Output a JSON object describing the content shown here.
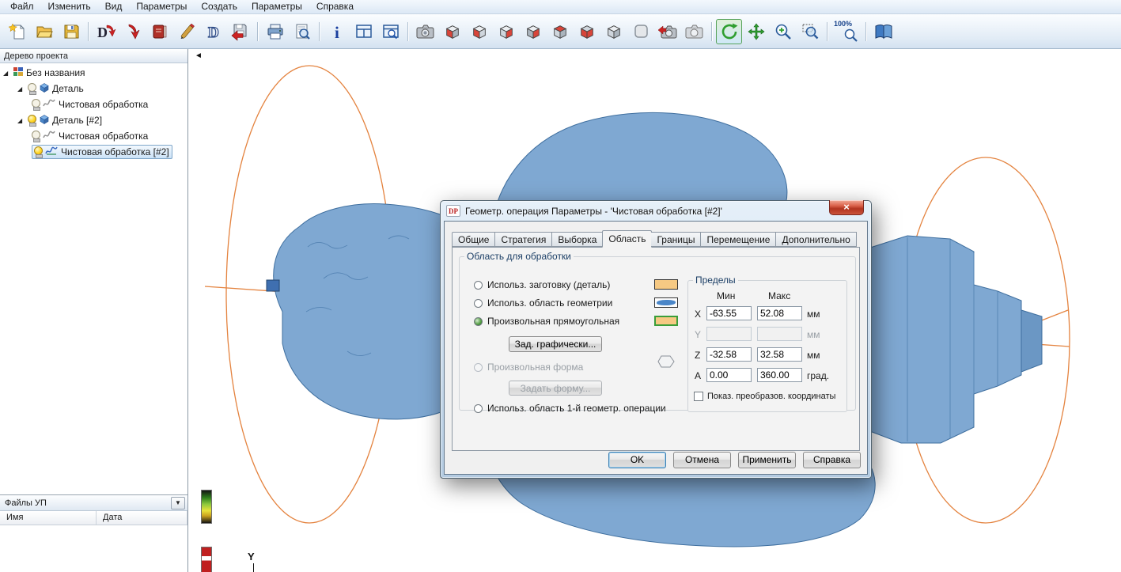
{
  "menu": {
    "items": [
      "Файл",
      "Изменить",
      "Вид",
      "Параметры",
      "Создать",
      "Параметры",
      "Справка"
    ]
  },
  "toolbar": {
    "zoom_label": "100%",
    "active_tool": "rotate",
    "icons": [
      "new-project",
      "open",
      "save",
      "import-drawing",
      "import-file",
      "library",
      "calculate",
      "drawing",
      "export-toolpath",
      "print",
      "print-preview",
      "info",
      "split-window",
      "view-window",
      "snapshot",
      "view-left",
      "view-front",
      "view-right",
      "view-back",
      "view-top",
      "view-bottom",
      "view-iso",
      "view-perspective",
      "restore-view",
      "saved-view",
      "rotate",
      "pan",
      "zoom-in",
      "zoom-window",
      "zoom-100",
      "help"
    ]
  },
  "project_tree": {
    "title": "Дерево проекта",
    "items": [
      {
        "label": "Без названия",
        "level": 0
      },
      {
        "label": "Деталь",
        "level": 1,
        "bulb": "off"
      },
      {
        "label": "Чистовая обработка",
        "level": 2,
        "bulb": "off"
      },
      {
        "label": "Деталь [#2]",
        "level": 1,
        "bulb": "on"
      },
      {
        "label": "Чистовая обработка",
        "level": 2,
        "bulb": "off"
      },
      {
        "label": "Чистовая обработка [#2]",
        "level": 2,
        "bulb": "on",
        "selected": true
      }
    ]
  },
  "files_panel": {
    "title": "Файлы УП",
    "columns": [
      "Имя",
      "Дата"
    ]
  },
  "viewport": {
    "axis_label": "Y"
  },
  "dialog": {
    "logo_text": "DP",
    "title": "Геометр. операция Параметры - 'Чистовая обработка [#2]'",
    "tabs": [
      "Общие",
      "Стратегия",
      "Выборка",
      "Область",
      "Границы",
      "Перемещение",
      "Дополнительно"
    ],
    "active_tab": "Область",
    "area_group": {
      "title": "Область для обработки",
      "options": [
        {
          "label": "Использ. заготовку (деталь)",
          "state": "unchecked"
        },
        {
          "label": "Использ. область геометрии",
          "state": "unchecked"
        },
        {
          "label": "Произвольная прямоугольная",
          "state": "checked"
        },
        {
          "label": "Произвольная форма",
          "state": "disabled"
        },
        {
          "label": "Использ. область 1-й геометр. операции",
          "state": "unchecked"
        }
      ],
      "define_graphically_button": "Зад. графически...",
      "define_shape_button": "Задать форму..."
    },
    "limits_group": {
      "title": "Пределы",
      "min_header": "Мин",
      "max_header": "Макс",
      "rows": [
        {
          "axis": "X",
          "min": "-63.55",
          "max": "52.08",
          "unit": "мм",
          "enabled": true
        },
        {
          "axis": "Y",
          "min": "",
          "max": "",
          "unit": "мм",
          "enabled": false
        },
        {
          "axis": "Z",
          "min": "-32.58",
          "max": "32.58",
          "unit": "мм",
          "enabled": true
        },
        {
          "axis": "A",
          "min": "0.00",
          "max": "360.00",
          "unit": "град.",
          "enabled": true
        }
      ],
      "show_transformed_label": "Показ. преобразов. координаты",
      "show_transformed_checked": false
    },
    "buttons": [
      "OK",
      "Отмена",
      "Применить",
      "Справка"
    ]
  },
  "colors": {
    "model_blue": "#7fa8d2",
    "axis_orange": "#e4833f",
    "selection_blue": "#cbe2f7",
    "active_radio_green": "#4f9a3f"
  }
}
